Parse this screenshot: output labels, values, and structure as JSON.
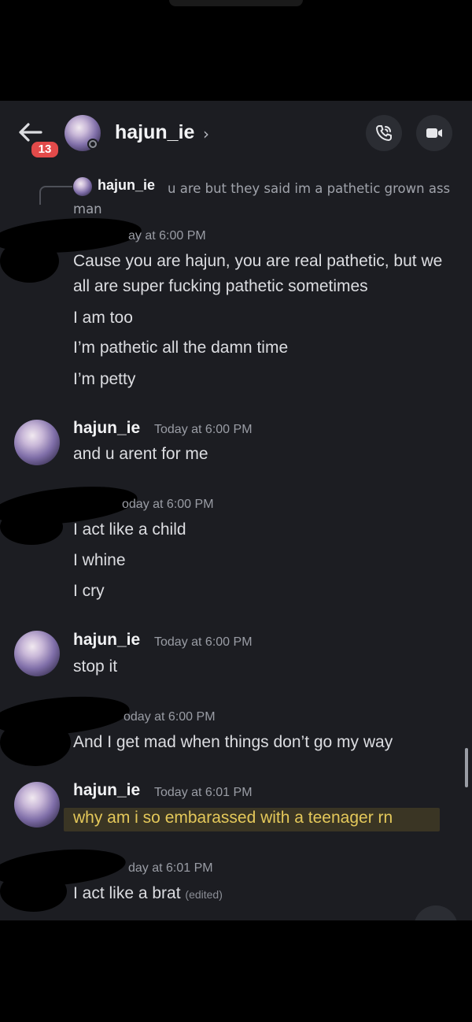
{
  "header": {
    "unread_count": "13",
    "title": "hajun_ie",
    "chevron": "›"
  },
  "reply": {
    "author": "hajun_ie",
    "text": "u are but they said im a pathetic grown ass man"
  },
  "messages": [
    {
      "author": "",
      "timestamp": "ay at 6:00 PM",
      "lines": [
        "Cause you  are hajun, you are real pathetic, but we all are super fucking pathetic sometimes",
        "I am too",
        "I’m pathetic all the damn time",
        "I’m petty"
      ]
    },
    {
      "author": "hajun_ie",
      "timestamp": "Today at 6:00 PM",
      "lines": [
        "and u arent for me"
      ]
    },
    {
      "author": "",
      "timestamp": "oday at 6:00 PM",
      "lines": [
        "I act like a child",
        "I whine",
        "I cry"
      ]
    },
    {
      "author": "hajun_ie",
      "timestamp": "Today at 6:00 PM",
      "lines": [
        "stop it"
      ]
    },
    {
      "author": "",
      "timestamp": "oday at 6:00 PM",
      "lines": [
        "And I get mad when things don’t go my way"
      ]
    },
    {
      "author": "hajun_ie",
      "timestamp": "Today at 6:01 PM",
      "lines": [
        "why am i so embarassed with a teenager rn"
      ]
    },
    {
      "author": "",
      "timestamp": "day at 6:01 PM",
      "lines": [
        "I act like a brat"
      ],
      "edited": "(edited)"
    }
  ],
  "colors": {
    "background": "#1c1d22",
    "badge": "#e24a4a",
    "highlight_text": "#e4c85a"
  },
  "icons": [
    "back-arrow-icon",
    "phone-call-icon",
    "video-camera-icon",
    "chevron-right-icon"
  ]
}
